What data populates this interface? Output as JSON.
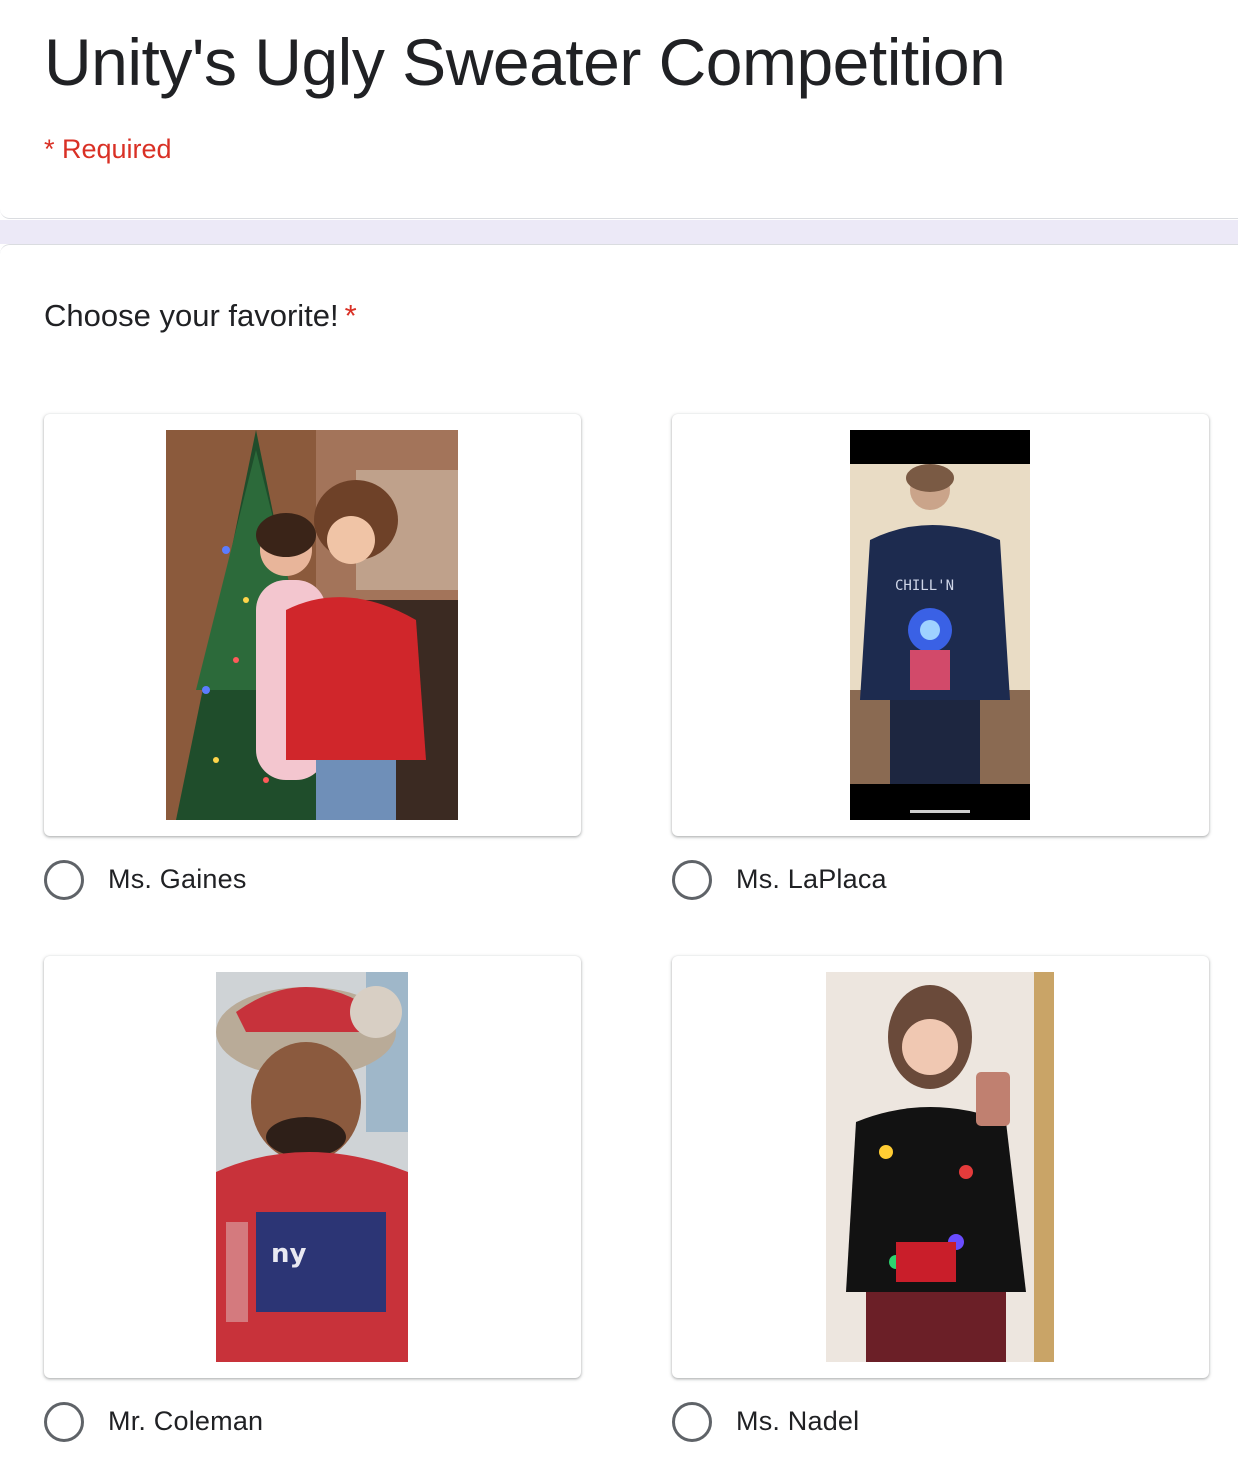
{
  "form": {
    "title": "Unity's Ugly Sweater Competition",
    "required_note": "* Required"
  },
  "question": {
    "title": "Choose your favorite!",
    "required_marker": "*",
    "options": [
      {
        "label": "Ms. Gaines",
        "selected": false,
        "image": "photo-woman-and-child-by-christmas-tree"
      },
      {
        "label": "Ms. LaPlaca",
        "selected": false,
        "image": "photo-woman-in-lit-penguin-sweater"
      },
      {
        "label": "Mr. Coleman",
        "selected": false,
        "image": "photo-man-in-giants-santa-hat"
      },
      {
        "label": "Ms. Nadel",
        "selected": false,
        "image": "photo-woman-in-light-up-holiday-sweater"
      }
    ]
  },
  "colors": {
    "required_red": "#d93025",
    "band": "#ece9f7",
    "radio_border": "#5f6368",
    "text": "#202124"
  }
}
